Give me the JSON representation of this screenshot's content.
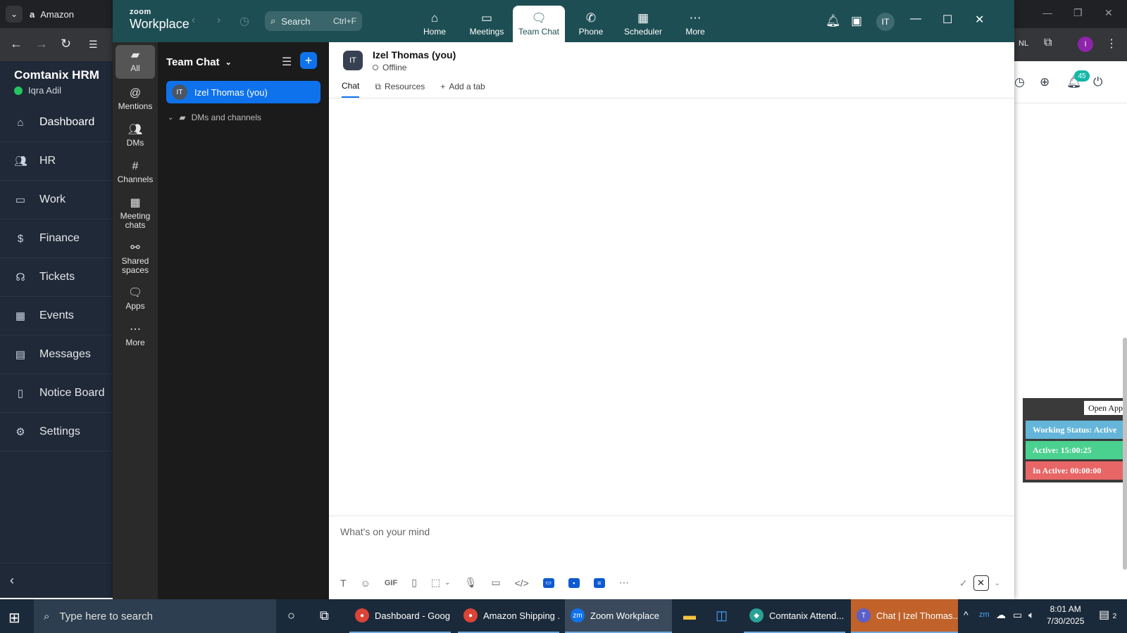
{
  "browser": {
    "tab_title": "Amazon",
    "profile_initial": "I",
    "ext_badge": "NL"
  },
  "hrm": {
    "brand": "Comtanix HRM",
    "user": "Iqra Adil",
    "nav": [
      {
        "label": "Dashboard",
        "icon": "home-icon"
      },
      {
        "label": "HR",
        "icon": "users-icon"
      },
      {
        "label": "Work",
        "icon": "briefcase-icon"
      },
      {
        "label": "Finance",
        "icon": "dollar-icon"
      },
      {
        "label": "Tickets",
        "icon": "headset-icon"
      },
      {
        "label": "Events",
        "icon": "calendar-icon"
      },
      {
        "label": "Messages",
        "icon": "message-icon"
      },
      {
        "label": "Notice Board",
        "icon": "clipboard-icon"
      },
      {
        "label": "Settings",
        "icon": "gear-icon"
      }
    ],
    "notif_count": "45"
  },
  "status_widget": {
    "open_app": "Open App",
    "working": "Working Status: Active",
    "active": "Active: 15:00:25",
    "inactive": "In Active: 00:00:00"
  },
  "zoom": {
    "logo_top": "zoom",
    "logo_bottom": "Workplace",
    "search_label": "Search",
    "search_shortcut": "Ctrl+F",
    "tabs": [
      {
        "label": "Home",
        "icon": "home-icon"
      },
      {
        "label": "Meetings",
        "icon": "video-icon"
      },
      {
        "label": "Team Chat",
        "icon": "chat-icon"
      },
      {
        "label": "Phone",
        "icon": "phone-icon"
      },
      {
        "label": "Scheduler",
        "icon": "calendar-icon"
      },
      {
        "label": "More",
        "icon": "more-icon"
      }
    ],
    "avatar_initials": "IT",
    "rail": [
      {
        "label": "All"
      },
      {
        "label": "Mentions"
      },
      {
        "label": "DMs"
      },
      {
        "label": "Channels"
      },
      {
        "label": "Meeting chats"
      },
      {
        "label": "Shared spaces"
      },
      {
        "label": "Apps"
      },
      {
        "label": "More"
      }
    ],
    "list_title": "Team Chat",
    "me_item": "Izel Thomas (you)",
    "section_label": "DMs and channels",
    "chat": {
      "name": "Izel Thomas (you)",
      "status": "Offline",
      "tabs": [
        "Chat",
        "Resources",
        "Add a tab"
      ],
      "placeholder": "What's on your mind"
    }
  },
  "taskbar": {
    "search_placeholder": "Type here to search",
    "apps": [
      {
        "label": "Dashboard - Goog..."
      },
      {
        "label": "Amazon Shipping ..."
      },
      {
        "label": "Zoom Workplace"
      },
      {
        "label": "Comtanix Attend..."
      },
      {
        "label": "Chat | Izel Thomas..."
      }
    ],
    "time": "8:01 AM",
    "date": "7/30/2025",
    "notif_count": "2"
  }
}
